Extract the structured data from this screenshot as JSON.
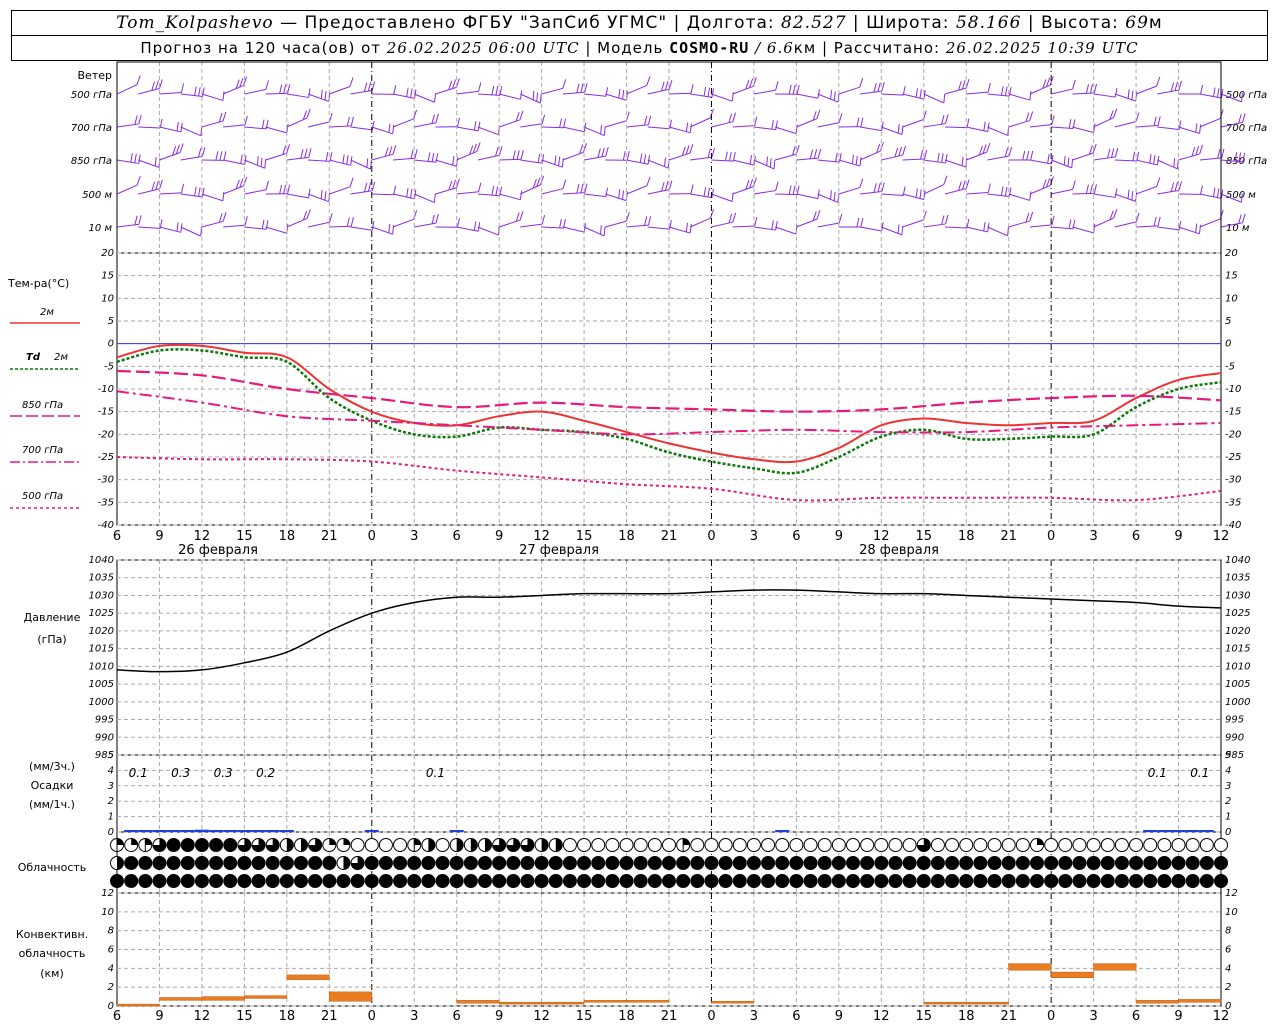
{
  "header": {
    "station": "Tom_Kolpashevo",
    "provider": " — Предоставлено ФГБУ \"ЗапСиб УГМС\" | Долгота: ",
    "lon": "82.527",
    "lat_label": " | Широта: ",
    "lat": "58.166",
    "alt_label": " | Высота: ",
    "alt": "69",
    "alt_unit": "м",
    "forecast_label": "Прогноз на 120 часа(ов) от ",
    "forecast_from": "26.02.2025 06:00 UTC",
    "model_label": " | Модель ",
    "model": "COSMO-RU",
    "model_res": " / 6.6",
    "model_res_unit": "км",
    "calc_label": " | Рассчитано: ",
    "calc_time": "26.02.2025 10:39 UTC"
  },
  "colors": {
    "t2m": "#ee3333",
    "td": "#0a7a0a",
    "t850": "#e6197d",
    "t700": "#e6197d",
    "t500": "#e6197d",
    "wind": "#8a2be2",
    "precip": "#1e3fe0",
    "conv": "#ea7d22",
    "zero": "#3333ff"
  },
  "wind_panel": {
    "title": "Ветер",
    "levels": [
      "500 гПа",
      "700 гПа",
      "850 гПа",
      "500 м",
      "10 м"
    ]
  },
  "legend": {
    "temp_title": "Тем-ра(°C)",
    "t2m": "2м",
    "td_symbol": "Td",
    "td": "2м",
    "t850": "850 гПа",
    "t700": "700 гПа",
    "t500": "500 гПа"
  },
  "pressure_panel": {
    "title1": "Давление",
    "title2": "(гПа)"
  },
  "precip_panel": {
    "unit3h": "(мм/3ч.)",
    "title": "Осадки",
    "unit1h": "(мм/1ч.)"
  },
  "cloud_panel": {
    "title": "Облачность"
  },
  "conv_panel": {
    "title1": "Конвективн.",
    "title2": "облачность",
    "title3": "(км)"
  },
  "dates": [
    "26 февраля",
    "27 февраля",
    "28 февраля"
  ],
  "x_hour_labels": [
    "6",
    "9",
    "12",
    "15",
    "18",
    "21",
    "0",
    "3",
    "6",
    "9",
    "12",
    "15",
    "18",
    "21",
    "0",
    "3",
    "6",
    "9",
    "12",
    "15",
    "18",
    "21",
    "0",
    "3",
    "6",
    "9",
    "12"
  ],
  "chart_data": [
    {
      "type": "line",
      "panel": "temperature",
      "x_unit": "hours since 26.02.2025 06:00 UTC",
      "ylabel": "Тем-ра(°C)",
      "ylim": [
        -40,
        20
      ],
      "yticks": [
        -40,
        -35,
        -30,
        -25,
        -20,
        -15,
        -10,
        -5,
        0,
        5,
        10,
        15,
        20
      ],
      "series": [
        {
          "name": "2м",
          "key": "t2m",
          "x": [
            0,
            3,
            6,
            9,
            12,
            15,
            18,
            21,
            24,
            27,
            30,
            33,
            36,
            39,
            42,
            45,
            48,
            51,
            54,
            57,
            60,
            63,
            66,
            69,
            72,
            75,
            78
          ],
          "values": [
            -3,
            -0.5,
            -0.5,
            -2,
            -3,
            -10,
            -15,
            -17.5,
            -18,
            -16,
            -15,
            -17,
            -19.5,
            -22,
            -24,
            -25.5,
            -26,
            -23,
            -18,
            -16.5,
            -17.5,
            -18,
            -17.5,
            -17,
            -12,
            -8,
            -6.5
          ]
        },
        {
          "name": "Td 2м",
          "key": "td",
          "x": [
            0,
            3,
            6,
            9,
            12,
            15,
            18,
            21,
            24,
            27,
            30,
            33,
            36,
            39,
            42,
            45,
            48,
            51,
            54,
            57,
            60,
            63,
            66,
            69,
            72,
            75,
            78
          ],
          "values": [
            -4,
            -1.5,
            -1.5,
            -3,
            -4,
            -12,
            -17,
            -20,
            -20.5,
            -18.5,
            -19,
            -19.5,
            -21,
            -24,
            -26,
            -27.5,
            -28.5,
            -25,
            -20.5,
            -19,
            -21,
            -21,
            -20.5,
            -20,
            -14,
            -10,
            -8.5
          ]
        },
        {
          "name": "850 гПа",
          "key": "t850",
          "x": [
            0,
            6,
            12,
            18,
            24,
            30,
            36,
            42,
            48,
            54,
            60,
            66,
            72,
            78
          ],
          "values": [
            -6,
            -7,
            -10,
            -12,
            -14,
            -13,
            -14,
            -14.5,
            -15,
            -14.5,
            -13,
            -12,
            -11.5,
            -12.5
          ]
        },
        {
          "name": "700 гПа",
          "key": "t700",
          "x": [
            0,
            6,
            12,
            18,
            24,
            30,
            36,
            42,
            48,
            54,
            60,
            66,
            72,
            78
          ],
          "values": [
            -10.5,
            -13,
            -16,
            -17,
            -18,
            -19,
            -20,
            -19.5,
            -19,
            -19.5,
            -19.5,
            -18.5,
            -18,
            -17.5
          ]
        },
        {
          "name": "500 гПа",
          "key": "t500",
          "x": [
            0,
            6,
            12,
            18,
            24,
            30,
            36,
            42,
            48,
            54,
            60,
            66,
            72,
            78
          ],
          "values": [
            -25,
            -25.5,
            -25.5,
            -26,
            -28,
            -29.5,
            -31,
            -32,
            -34.5,
            -34,
            -34,
            -34,
            -34.5,
            -32.5
          ]
        }
      ]
    },
    {
      "type": "line",
      "panel": "pressure",
      "ylabel": "Давление (гПа)",
      "ylim": [
        985,
        1040
      ],
      "yticks": [
        985,
        990,
        995,
        1000,
        1005,
        1010,
        1015,
        1020,
        1025,
        1030,
        1035,
        1040
      ],
      "series": [
        {
          "name": "Давление",
          "key": "p",
          "x": [
            0,
            3,
            6,
            9,
            12,
            15,
            18,
            21,
            24,
            27,
            30,
            33,
            36,
            39,
            42,
            45,
            48,
            51,
            54,
            57,
            60,
            63,
            66,
            69,
            72,
            75,
            78
          ],
          "values": [
            1009,
            1008.5,
            1009,
            1011,
            1014,
            1020,
            1025,
            1028,
            1029.5,
            1029.5,
            1030,
            1030.5,
            1030.5,
            1030.5,
            1031,
            1031.5,
            1031.5,
            1031,
            1030.5,
            1030.5,
            1030,
            1029.5,
            1029,
            1028.5,
            1028,
            1027,
            1026.5
          ]
        }
      ]
    },
    {
      "type": "bar",
      "panel": "precipitation",
      "ylim": [
        0,
        5
      ],
      "yticks": [
        0,
        1,
        2,
        3,
        4,
        5
      ],
      "labels_3h": [
        {
          "x": 1.5,
          "text": "0.1"
        },
        {
          "x": 4.5,
          "text": "0.3"
        },
        {
          "x": 7.5,
          "text": "0.3"
        },
        {
          "x": 10.5,
          "text": "0.2"
        },
        {
          "x": 22.5,
          "text": "0.1"
        },
        {
          "x": 73.5,
          "text": "0.1"
        },
        {
          "x": 76.5,
          "text": "0.1"
        }
      ],
      "x": [
        1,
        2,
        3,
        4,
        5,
        6,
        7,
        8,
        9,
        10,
        11,
        12,
        18,
        24,
        47,
        73,
        74,
        75,
        76,
        77
      ],
      "values": [
        0.05,
        0.05,
        0.08,
        0.08,
        0.1,
        0.15,
        0.12,
        0.05,
        0.05,
        0.03,
        0.05,
        0.05,
        0.03,
        0.03,
        0.03,
        0.05,
        0.05,
        0.06,
        0.06,
        0.05
      ]
    },
    {
      "type": "table",
      "panel": "cloudiness",
      "rows": [
        "121788888775445220000130444555440000000010000000000000000500000002000000000000000000000000",
        "488888888888888846888888888888888888888888888888888888888888888888888888888888888888888",
        "888888888888888888888888888888888888888888888888888888888888888888888888888888888888888"
      ]
    },
    {
      "type": "bar",
      "panel": "convective",
      "ylim": [
        0,
        12
      ],
      "yticks": [
        0,
        2,
        4,
        6,
        8,
        10,
        12
      ],
      "segments": [
        {
          "x0": 0,
          "x1": 3,
          "bottom": 0,
          "top": 0.2
        },
        {
          "x0": 3,
          "x1": 6,
          "bottom": 0.6,
          "top": 0.9
        },
        {
          "x0": 6,
          "x1": 9,
          "bottom": 0.6,
          "top": 1.0
        },
        {
          "x0": 9,
          "x1": 12,
          "bottom": 0.8,
          "top": 1.1
        },
        {
          "x0": 12,
          "x1": 15,
          "bottom": 2.8,
          "top": 3.3
        },
        {
          "x0": 15,
          "x1": 18,
          "bottom": 0.5,
          "top": 1.5
        },
        {
          "x0": 24,
          "x1": 27,
          "bottom": 0.3,
          "top": 0.6
        },
        {
          "x0": 27,
          "x1": 30,
          "bottom": 0.2,
          "top": 0.4
        },
        {
          "x0": 30,
          "x1": 33,
          "bottom": 0.2,
          "top": 0.4
        },
        {
          "x0": 33,
          "x1": 36,
          "bottom": 0.4,
          "top": 0.6
        },
        {
          "x0": 36,
          "x1": 39,
          "bottom": 0.4,
          "top": 0.6
        },
        {
          "x0": 42,
          "x1": 45,
          "bottom": 0.3,
          "top": 0.5
        },
        {
          "x0": 57,
          "x1": 60,
          "bottom": 0.2,
          "top": 0.4
        },
        {
          "x0": 60,
          "x1": 63,
          "bottom": 0.2,
          "top": 0.4
        },
        {
          "x0": 63,
          "x1": 66,
          "bottom": 3.8,
          "top": 4.5
        },
        {
          "x0": 66,
          "x1": 69,
          "bottom": 3.0,
          "top": 3.6
        },
        {
          "x0": 69,
          "x1": 72,
          "bottom": 3.8,
          "top": 4.5
        },
        {
          "x0": 72,
          "x1": 75,
          "bottom": 0.3,
          "top": 0.6
        },
        {
          "x0": 75,
          "x1": 78,
          "bottom": 0.4,
          "top": 0.7
        }
      ]
    }
  ]
}
